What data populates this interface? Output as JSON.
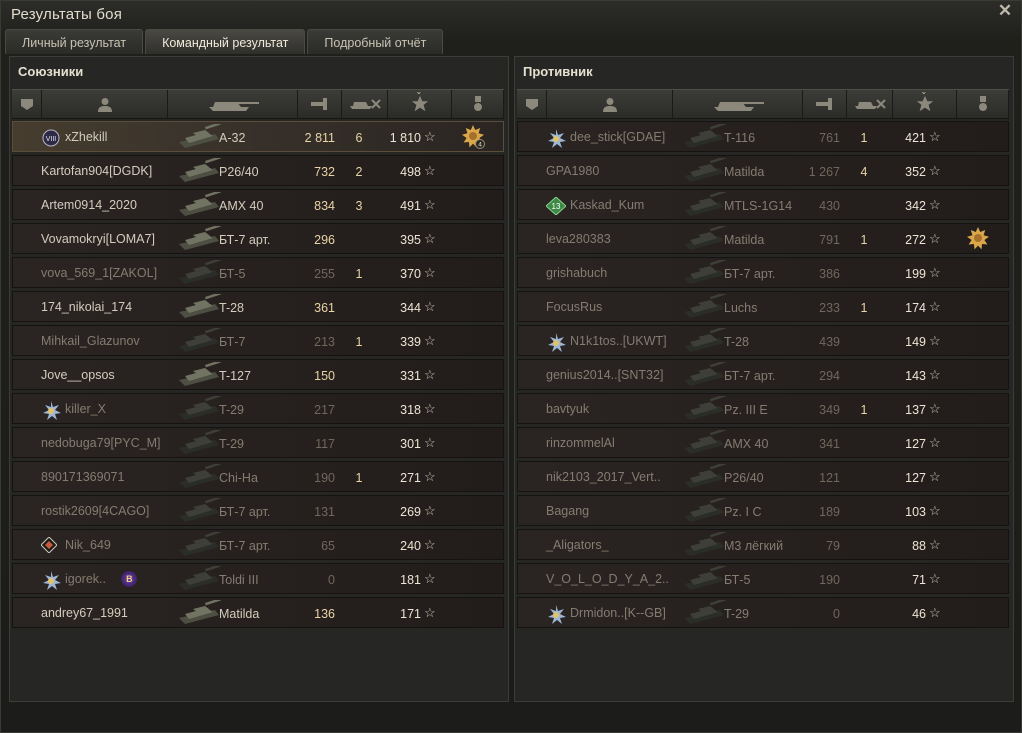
{
  "window": {
    "title": "Результаты боя"
  },
  "tabs": [
    {
      "label": "Личный результат",
      "active": false
    },
    {
      "label": "Командный результат",
      "active": true
    },
    {
      "label": "Подробный отчёт",
      "active": false
    }
  ],
  "allies": {
    "title": "Союзники",
    "rows": [
      {
        "name": "xZhekill",
        "badge": "rank-VIII-badge",
        "badge_text": "VIII",
        "vehicle": "A-32",
        "damage": "2 811",
        "kills": "6",
        "xp": "1 810",
        "medal": "medal-icon",
        "medal_count": "4",
        "highlight": true,
        "dim": false
      },
      {
        "name": "Kartofan904[DGDK]",
        "badge": "",
        "vehicle": "P26/40",
        "damage": "732",
        "kills": "2",
        "xp": "498",
        "dim": false
      },
      {
        "name": "Artem0914_2020",
        "badge": "",
        "vehicle": "AMX 40",
        "damage": "834",
        "kills": "3",
        "xp": "491",
        "dim": false
      },
      {
        "name": "Vovamokryi[LOMA7]",
        "badge": "",
        "vehicle": "БТ-7 арт.",
        "damage": "296",
        "kills": "",
        "xp": "395",
        "dim": false
      },
      {
        "name": "vova_569_1[ZAKOL]",
        "badge": "",
        "vehicle": "БТ-5",
        "damage": "255",
        "kills": "1",
        "xp": "370",
        "dim": true
      },
      {
        "name": "174_nikolai_174",
        "badge": "",
        "vehicle": "T-28",
        "damage": "361",
        "kills": "",
        "xp": "344",
        "dim": false
      },
      {
        "name": "Mihkail_Glazunov",
        "badge": "",
        "vehicle": "БТ-7",
        "damage": "213",
        "kills": "1",
        "xp": "339",
        "dim": true
      },
      {
        "name": "Jove__opsos",
        "badge": "",
        "vehicle": "T-127",
        "damage": "150",
        "kills": "",
        "xp": "331",
        "dim": false
      },
      {
        "name": "killer_X",
        "badge": "star-badge",
        "vehicle": "T-29",
        "damage": "217",
        "kills": "",
        "xp": "318",
        "dim": true
      },
      {
        "name": "nedobuga79[PYC_M]",
        "badge": "",
        "vehicle": "T-29",
        "damage": "117",
        "kills": "",
        "xp": "301",
        "dim": true
      },
      {
        "name": "890171369071",
        "badge": "",
        "vehicle": "Chi-Ha",
        "damage": "190",
        "kills": "1",
        "xp": "271",
        "dim": true
      },
      {
        "name": "rostik2609[4CAGO]",
        "badge": "",
        "vehicle": "БТ-7 арт.",
        "damage": "131",
        "kills": "",
        "xp": "269",
        "dim": true
      },
      {
        "name": "Nik_649",
        "badge": "diamond-badge",
        "vehicle": "БТ-7 арт.",
        "damage": "65",
        "kills": "",
        "xp": "240",
        "dim": true
      },
      {
        "name": "igorek..",
        "badge": "star-badge",
        "badge2": "B",
        "vehicle": "Toldi III",
        "damage": "0",
        "kills": "",
        "xp": "181",
        "dim": true
      },
      {
        "name": "andrey67_1991",
        "badge": "",
        "vehicle": "Matilda",
        "damage": "136",
        "kills": "",
        "xp": "171",
        "dim": false
      }
    ]
  },
  "enemies": {
    "title": "Противник",
    "rows": [
      {
        "name": "dee_stick[GDAE]",
        "badge": "star-badge",
        "vehicle": "T-116",
        "damage": "761",
        "kills": "1",
        "xp": "421",
        "dim": true
      },
      {
        "name": "GPA1980",
        "badge": "",
        "vehicle": "Matilda",
        "damage": "1 267",
        "kills": "4",
        "xp": "352",
        "dim": true
      },
      {
        "name": "Kaskad_Kum",
        "badge": "rank-13-badge",
        "badge_text": "13",
        "vehicle": "MTLS-1G14",
        "damage": "430",
        "kills": "",
        "xp": "342",
        "dim": true
      },
      {
        "name": "leva280383",
        "badge": "",
        "vehicle": "Matilda",
        "damage": "791",
        "kills": "1",
        "xp": "272",
        "medal": "medal-icon",
        "dim": true
      },
      {
        "name": "grishabuch",
        "badge": "",
        "vehicle": "БТ-7 арт.",
        "damage": "386",
        "kills": "",
        "xp": "199",
        "dim": true
      },
      {
        "name": "FocusRus",
        "badge": "",
        "vehicle": "Luchs",
        "damage": "233",
        "kills": "1",
        "xp": "174",
        "dim": true
      },
      {
        "name": "N1k1tos..[UKWT]",
        "badge": "star-badge",
        "vehicle": "T-28",
        "damage": "439",
        "kills": "",
        "xp": "149",
        "dim": true
      },
      {
        "name": "genius2014..[SNT32]",
        "badge": "",
        "vehicle": "БТ-7 арт.",
        "damage": "294",
        "kills": "",
        "xp": "143",
        "dim": true
      },
      {
        "name": "bavtyuk",
        "badge": "",
        "vehicle": "Pz. III E",
        "damage": "349",
        "kills": "1",
        "xp": "137",
        "dim": true
      },
      {
        "name": "rinzommelAl",
        "badge": "",
        "vehicle": "AMX 40",
        "damage": "341",
        "kills": "",
        "xp": "127",
        "dim": true
      },
      {
        "name": "nik2103_2017_Vert..",
        "badge": "",
        "vehicle": "P26/40",
        "damage": "121",
        "kills": "",
        "xp": "127",
        "dim": true
      },
      {
        "name": "Bagang",
        "badge": "",
        "vehicle": "Pz. I C",
        "damage": "189",
        "kills": "",
        "xp": "103",
        "dim": true
      },
      {
        "name": "_Aligators_",
        "badge": "",
        "vehicle": "M3 лёгкий",
        "damage": "79",
        "kills": "",
        "xp": "88",
        "dim": true
      },
      {
        "name": "V_O_L_O_D_Y_A_2..",
        "badge": "",
        "vehicle": "БТ-5",
        "damage": "190",
        "kills": "",
        "xp": "71",
        "dim": true
      },
      {
        "name": "Drmidon..[K--GB]",
        "badge": "star-badge",
        "vehicle": "T-29",
        "damage": "0",
        "kills": "",
        "xp": "46",
        "dim": true
      }
    ]
  },
  "columns": {
    "icons": [
      "squad-icon",
      "player-icon",
      "tank-icon",
      "damage-icon",
      "kills-icon",
      "xp-star-icon",
      "medal-column-icon"
    ],
    "star_glyph": "☆"
  },
  "colors": {
    "accent": "#e8d4a6",
    "text": "#d2cdbd",
    "dim_text": "#857c70",
    "highlight_row": "#463d2f"
  }
}
